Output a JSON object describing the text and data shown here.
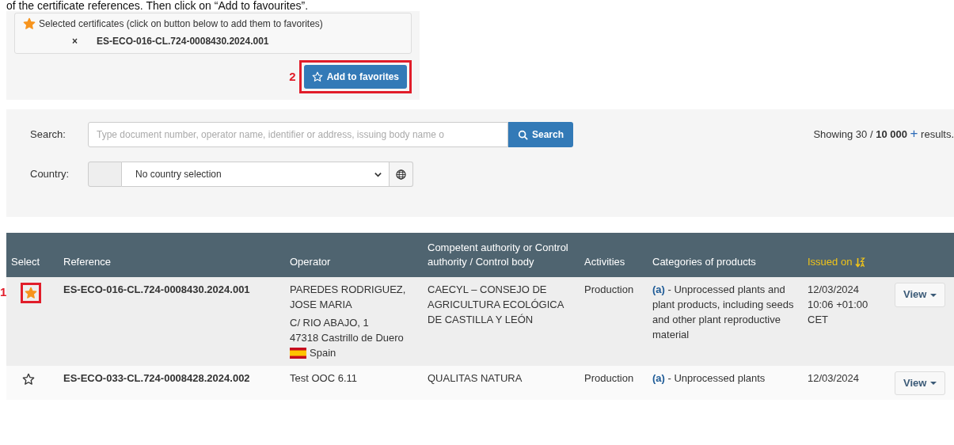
{
  "instruction_text": "of the certificate references. Then click on “Add to favourites”.",
  "selection_panel": {
    "title": "Selected certificates (click on button below to add them to favorites)",
    "items": [
      {
        "remove": "×",
        "reference": "ES-ECO-016-CL.724-0008430.2024.001"
      }
    ]
  },
  "add_button": {
    "label": "Add to favorites",
    "annotation": "2"
  },
  "search": {
    "label": "Search:",
    "placeholder": "Type document number, operator name, identifier or address, issuing body name o",
    "button": "Search",
    "results_prefix": "Showing 30 / ",
    "results_count": "10 000",
    "results_more": "+",
    "results_suffix": " results."
  },
  "country": {
    "label": "Country:",
    "value": "No country selection"
  },
  "table": {
    "columns": [
      {
        "label": "Select",
        "sorted": false
      },
      {
        "label": "Reference",
        "sorted": false
      },
      {
        "label": "Operator",
        "sorted": false
      },
      {
        "label": "Competent authority or Control authority / Control body",
        "sorted": false
      },
      {
        "label": "Activities",
        "sorted": false
      },
      {
        "label": "Categories of products",
        "sorted": false
      },
      {
        "label": "Issued on",
        "sorted": true
      }
    ],
    "rows": [
      {
        "selected": true,
        "annotation": "1",
        "reference": "ES-ECO-016-CL.724-0008430.2024.001",
        "operator": "PAREDES RODRIGUEZ, JOSE MARIA",
        "address": [
          "C/ RIO ABAJO, 1",
          "47318 Castrillo de Duero"
        ],
        "country": "Spain",
        "authority": "CAECYL – CONSEJO DE AGRICULTURA ECOLÓGICA DE CASTILLA Y LEÓN",
        "activities": [
          "Production"
        ],
        "category_code": "(a)",
        "category": " - Unprocessed plants and plant products, including seeds and other plant reproductive material",
        "issued": [
          "12/03/2024",
          "10:06 +01:00",
          "CET"
        ],
        "action": "View"
      },
      {
        "selected": false,
        "reference": "ES-ECO-033-CL.724-0008428.2024.002",
        "operator": "Test OOC 6.11",
        "address": [],
        "authority": "QUALITAS NATURA",
        "activities": [
          "Production"
        ],
        "category_code": "(a)",
        "category": " - Unprocessed plants",
        "issued": [
          "12/03/2024"
        ],
        "action": "View"
      }
    ]
  }
}
